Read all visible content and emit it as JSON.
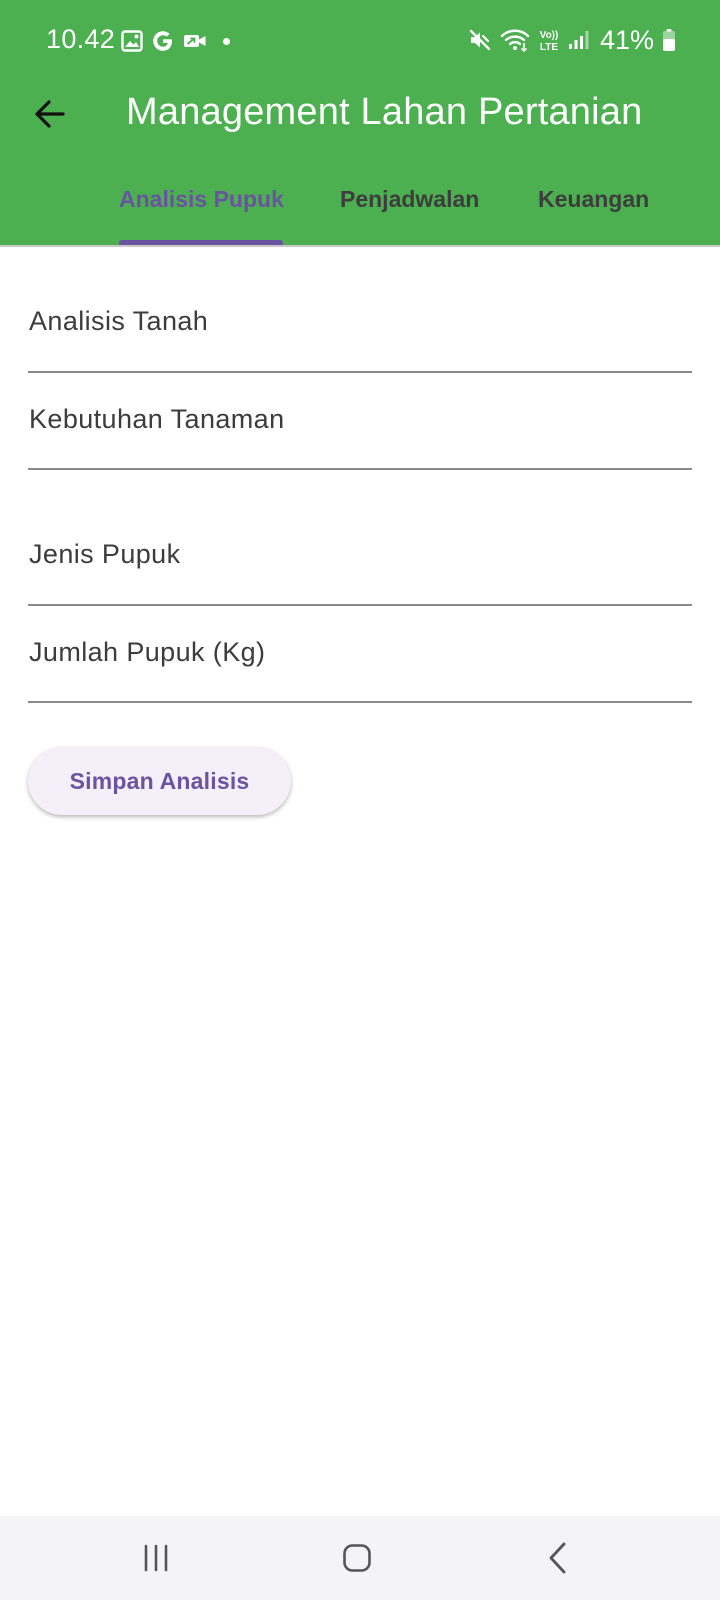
{
  "status_bar": {
    "time": "10.42",
    "battery_percent": "41%",
    "icons_left": [
      "gallery-icon",
      "google-g-icon",
      "video-camera-icon",
      "notification-dot"
    ],
    "icons_right": [
      "mute-icon",
      "wifi-icon",
      "volte-icon",
      "signal-icon",
      "battery-icon"
    ]
  },
  "app_bar": {
    "title": "Management Lahan Pertanian",
    "back_icon": "arrow-left-icon"
  },
  "tabs": [
    {
      "label": "Analisis Pupuk",
      "active": true
    },
    {
      "label": "Penjadwalan",
      "active": false
    },
    {
      "label": "Keuangan",
      "active": false
    }
  ],
  "form": {
    "fields": [
      {
        "label": "Analisis Tanah",
        "value": ""
      },
      {
        "label": "Kebutuhan Tanaman",
        "value": ""
      },
      {
        "label": "Jenis Pupuk",
        "value": ""
      },
      {
        "label": "Jumlah Pupuk (Kg)",
        "value": ""
      }
    ],
    "save_label": "Simpan Analisis"
  },
  "nav_bar": {
    "items": [
      "recent-apps-icon",
      "home-icon",
      "back-icon"
    ]
  },
  "colors": {
    "header_green": "#4caf50",
    "accent_purple": "#6a53a0",
    "button_bg": "#f4eff8",
    "navbar_bg": "#f4f4f6"
  }
}
